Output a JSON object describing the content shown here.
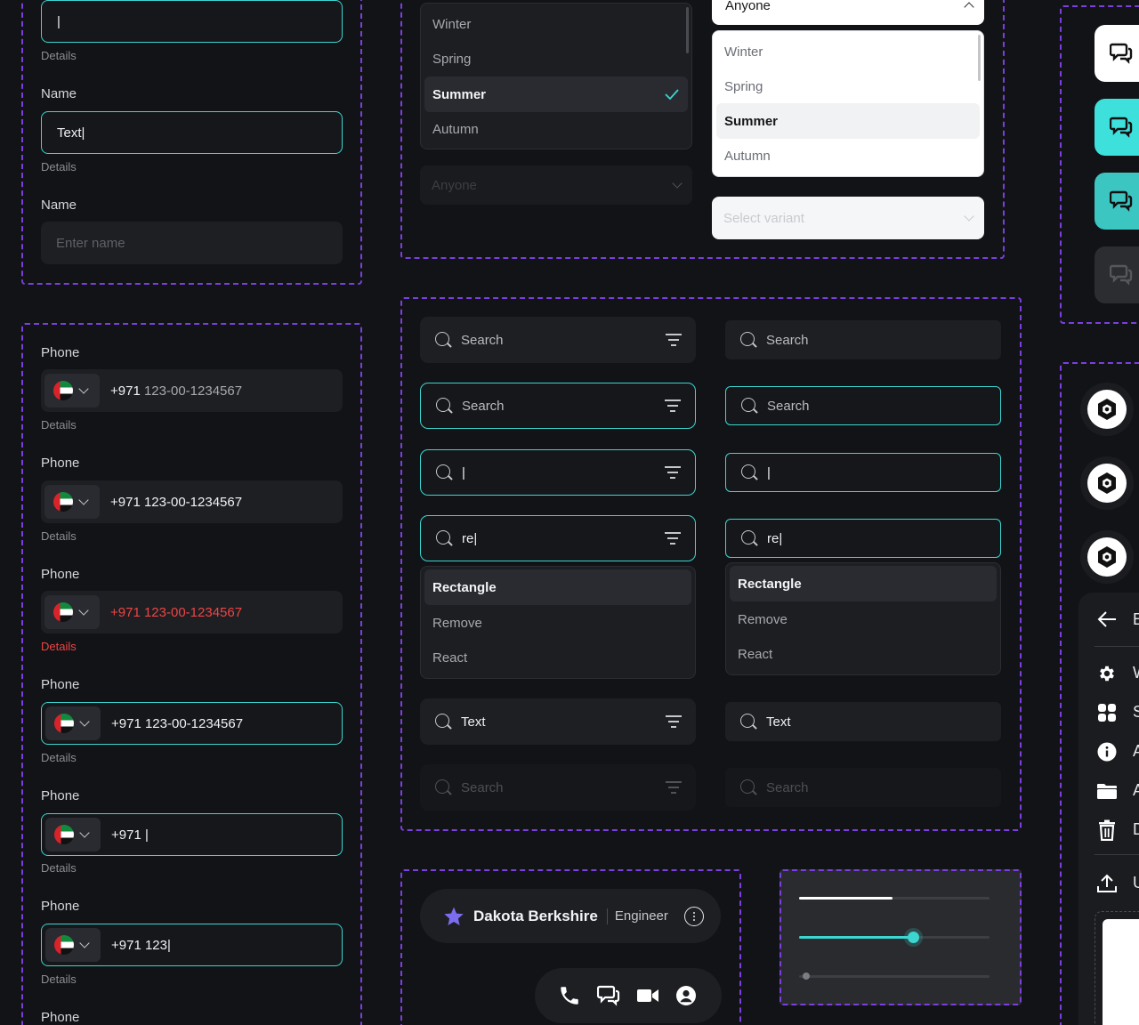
{
  "inputs": {
    "detailsText": "Details",
    "nameLabel": "Name",
    "cursorValue": "|",
    "textValue": "Text|",
    "placeholder": "Enter name"
  },
  "phones": {
    "label": "Phone",
    "details": "Details",
    "code": "+971",
    "number": "123-00-1234567",
    "partial1": "|",
    "partial2": "123|"
  },
  "dropdowns": {
    "options": [
      "Winter",
      "Spring",
      "Summer",
      "Autumn"
    ],
    "selected": "Summer",
    "dark_placeholder": "Anyone",
    "light_top_value": "Anyone",
    "light_placeholder": "Select variant"
  },
  "search": {
    "placeholder": "Search",
    "cursor": "|",
    "typed": "re|",
    "results": [
      "Rectangle",
      "Remove",
      "React"
    ],
    "text_value": "Text"
  },
  "user_chip": {
    "name": "Dakota Berkshire",
    "role": "Engineer"
  },
  "sliders": [
    {
      "value": 0.49
    },
    {
      "value": 0.6
    },
    {
      "value": 0.02
    }
  ],
  "sidebar": {
    "items": [
      {
        "icon": "gear-icon",
        "label": "W"
      },
      {
        "icon": "grid-icon",
        "label": "S"
      },
      {
        "icon": "info-icon",
        "label": "A"
      },
      {
        "icon": "folder-icon",
        "label": "A"
      },
      {
        "icon": "trash-icon",
        "label": "D"
      },
      {
        "icon": "upload-icon",
        "label": "U"
      }
    ],
    "header_label": "E"
  },
  "colors": {
    "accent": "#3cd5d0",
    "error": "#ef4444",
    "dash": "#7b3fe0",
    "star": "#7c6cf0"
  }
}
